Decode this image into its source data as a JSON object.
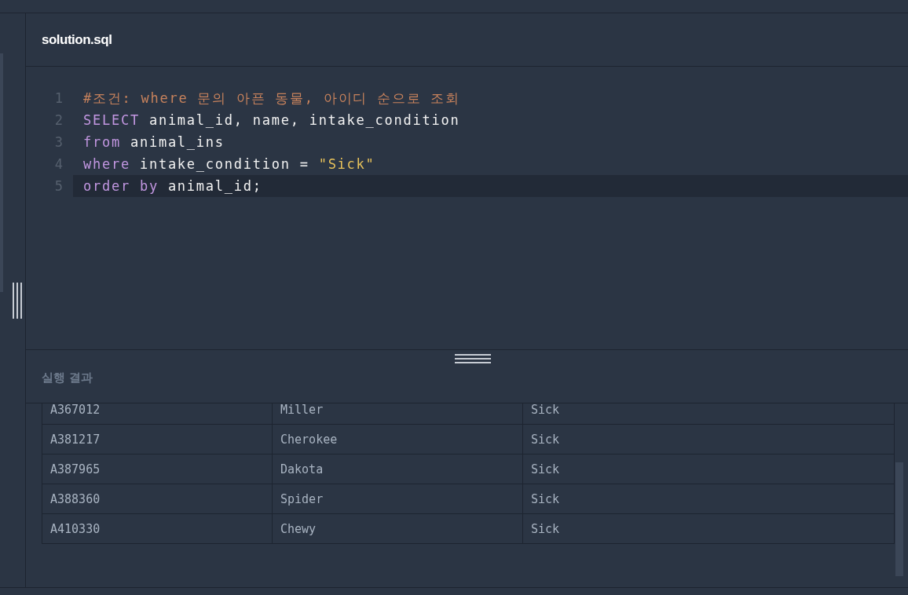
{
  "editor": {
    "filename": "solution.sql",
    "lines": [
      {
        "number": "1",
        "current": false,
        "tokens": [
          {
            "kind": "comment",
            "text": "#조건: where 문의 아픈 동물, 아이디 순으로 조회"
          }
        ]
      },
      {
        "number": "2",
        "current": false,
        "tokens": [
          {
            "kind": "keyword",
            "text": "SELECT"
          },
          {
            "kind": "plain",
            "text": " animal_id, name, intake_condition"
          }
        ]
      },
      {
        "number": "3",
        "current": false,
        "tokens": [
          {
            "kind": "keyword",
            "text": "from"
          },
          {
            "kind": "plain",
            "text": " animal_ins"
          }
        ]
      },
      {
        "number": "4",
        "current": false,
        "tokens": [
          {
            "kind": "keyword",
            "text": "where"
          },
          {
            "kind": "plain",
            "text": " intake_condition = "
          },
          {
            "kind": "string",
            "text": "\"Sick\""
          }
        ]
      },
      {
        "number": "5",
        "current": true,
        "tokens": [
          {
            "kind": "keyword",
            "text": "order by"
          },
          {
            "kind": "plain",
            "text": " animal_id;"
          }
        ]
      }
    ]
  },
  "results": {
    "title": "실행 결과",
    "rows": [
      [
        "A367012",
        "Miller",
        "Sick"
      ],
      [
        "A381217",
        "Cherokee",
        "Sick"
      ],
      [
        "A387965",
        "Dakota",
        "Sick"
      ],
      [
        "A388360",
        "Spider",
        "Sick"
      ],
      [
        "A410330",
        "Chewy",
        "Sick"
      ]
    ]
  }
}
